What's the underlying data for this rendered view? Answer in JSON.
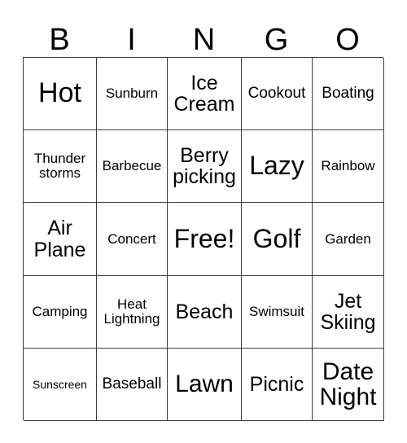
{
  "card": {
    "title": "BINGO",
    "header_letters": [
      "B",
      "I",
      "N",
      "G",
      "O"
    ],
    "free_space_label": "Free!",
    "colors": {
      "background": "#ffffff",
      "text": "#000000",
      "grid_line": "#3a3a3a"
    },
    "grid": {
      "columns": 5,
      "rows": 5,
      "cells": [
        [
          {
            "label": "Hot",
            "size": "xxl"
          },
          {
            "label": "Sunburn",
            "size": "xs"
          },
          {
            "label": "Ice\nCream",
            "size": "md"
          },
          {
            "label": "Cookout",
            "size": "sm"
          },
          {
            "label": "Boating",
            "size": "sm"
          }
        ],
        [
          {
            "label": "Thunder\nstorms",
            "size": "xs"
          },
          {
            "label": "Barbecue",
            "size": "xs"
          },
          {
            "label": "Berry\npicking",
            "size": "md"
          },
          {
            "label": "Lazy",
            "size": "xl"
          },
          {
            "label": "Rainbow",
            "size": "xs"
          }
        ],
        [
          {
            "label": "Air\nPlane",
            "size": "md"
          },
          {
            "label": "Concert",
            "size": "xs"
          },
          {
            "label": "Free!",
            "size": "xl"
          },
          {
            "label": "Golf",
            "size": "xl"
          },
          {
            "label": "Garden",
            "size": "xs"
          }
        ],
        [
          {
            "label": "Camping",
            "size": "xs"
          },
          {
            "label": "Heat\nLightning",
            "size": "xs"
          },
          {
            "label": "Beach",
            "size": "md"
          },
          {
            "label": "Swimsuit",
            "size": "xs"
          },
          {
            "label": "Jet\nSkiing",
            "size": "md"
          }
        ],
        [
          {
            "label": "Sunscreen",
            "size": "xxs"
          },
          {
            "label": "Baseball",
            "size": "sm"
          },
          {
            "label": "Lawn",
            "size": "lg"
          },
          {
            "label": "Picnic",
            "size": "md"
          },
          {
            "label": "Date\nNight",
            "size": "lg"
          }
        ]
      ]
    }
  }
}
